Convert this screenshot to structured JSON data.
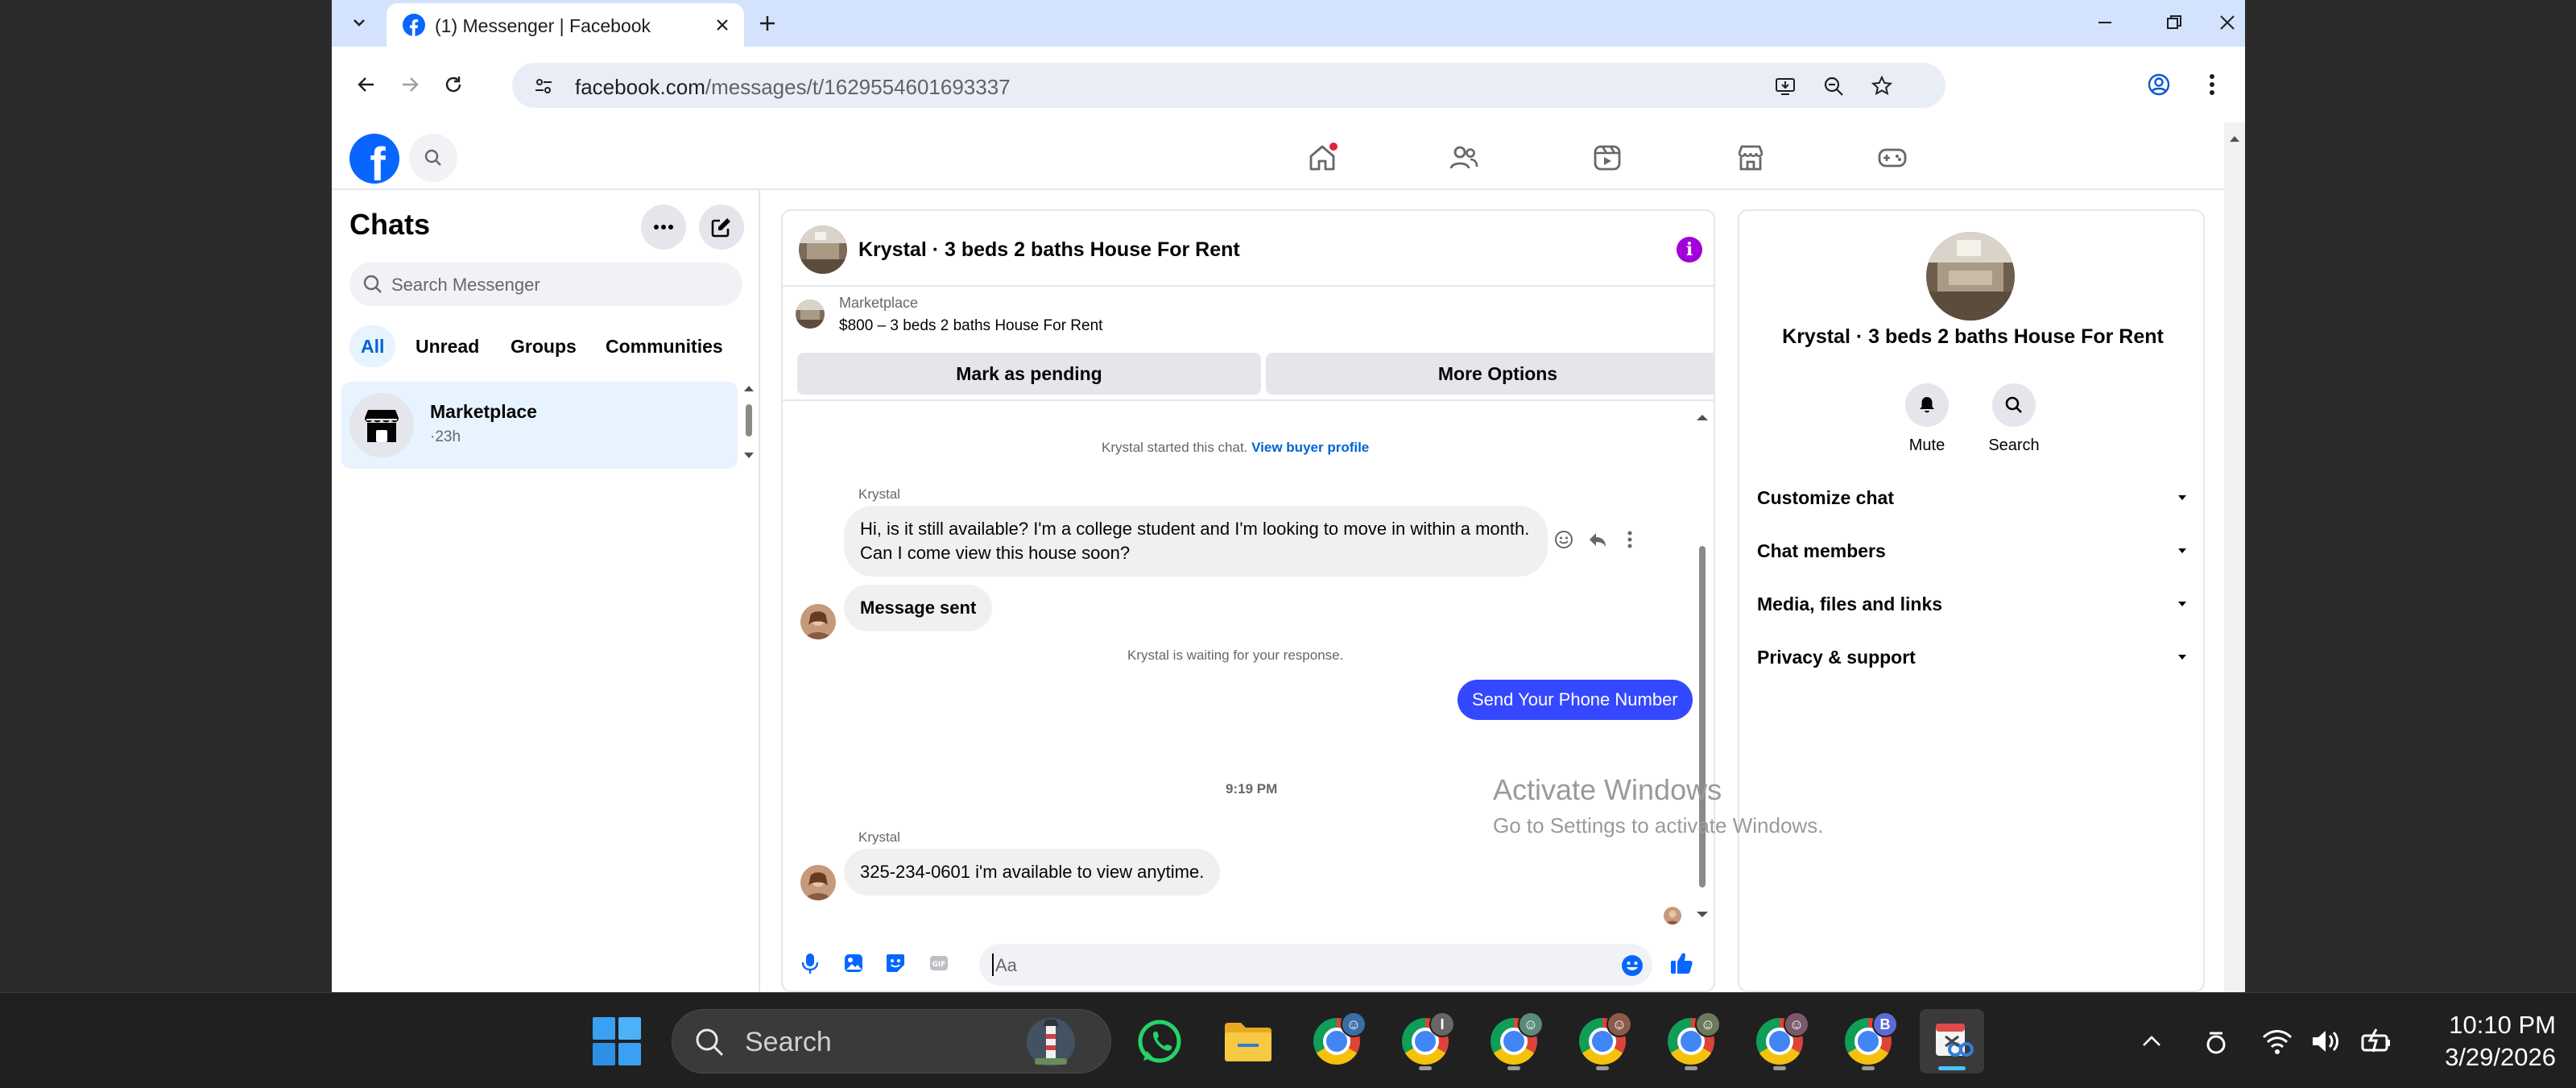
{
  "browser": {
    "tab_title": "(1) Messenger | Facebook",
    "url_host": "facebook.com",
    "url_path": "/messages/t/1629554601693337"
  },
  "facebook": {
    "notification_count": "1"
  },
  "chats": {
    "title": "Chats",
    "search_placeholder": "Search Messenger",
    "filters": [
      "All",
      "Unread",
      "Groups",
      "Communities"
    ],
    "items": [
      {
        "name": "Marketplace",
        "time": "·23h"
      }
    ]
  },
  "conversation": {
    "title": "Krystal · 3 beds 2 baths House For Rent",
    "marketplace_label": "Marketplace",
    "listing": "$800 – 3 beds 2 baths House For Rent",
    "mark_pending": "Mark as pending",
    "more_options": "More Options",
    "started_text": "Krystal started this chat.",
    "view_profile": "View buyer profile",
    "messages": {
      "sender1": "Krystal",
      "msg1": "Hi, is it still available? I'm a college student and I'm looking to move in within a month. Can I come view this house soon?",
      "msg2": "Message sent",
      "waiting": "Krystal is waiting for your response.",
      "msg3": "Send Your Phone Number",
      "timestamp": "9:19 PM",
      "sender2": "Krystal",
      "msg4": "325-234-0601 i'm available to view anytime."
    },
    "composer_placeholder": "Aa"
  },
  "info_panel": {
    "title": "Krystal · 3 beds 2 baths House For Rent",
    "mute": "Mute",
    "search": "Search",
    "sections": [
      "Customize chat",
      "Chat members",
      "Media, files and links",
      "Privacy & support"
    ]
  },
  "watermark": {
    "title": "Activate Windows",
    "subtitle": "Go to Settings to activate Windows."
  },
  "taskbar": {
    "search_label": "Search",
    "time": "10:10 PM",
    "date": "3/29/2026"
  },
  "colors": {
    "fb_blue": "#0866ff",
    "outgoing_bubble": "#3448ff",
    "selected_bg": "#e7f3ff",
    "info_purple": "#a200d8"
  }
}
